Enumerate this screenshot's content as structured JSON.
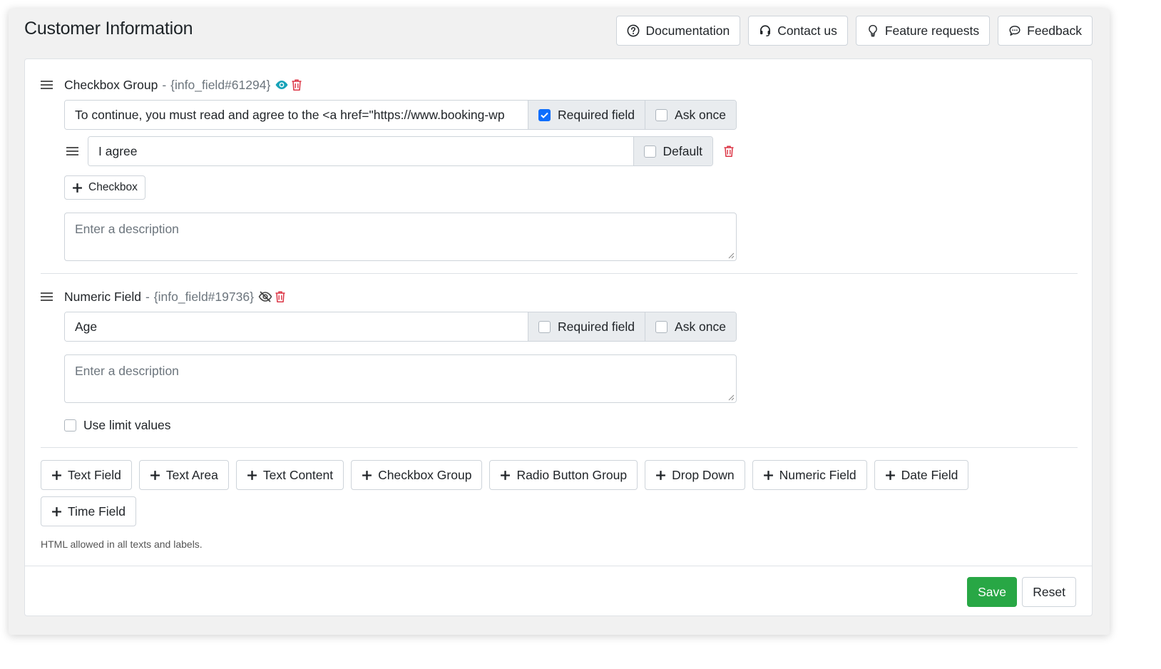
{
  "header": {
    "title": "Customer Information",
    "buttons": [
      {
        "label": "Documentation",
        "icon": "question-circle-icon"
      },
      {
        "label": "Contact us",
        "icon": "headset-icon"
      },
      {
        "label": "Feature requests",
        "icon": "lightbulb-icon"
      },
      {
        "label": "Feedback",
        "icon": "chat-bubble-icon"
      }
    ]
  },
  "fields": [
    {
      "type": "Checkbox Group",
      "separator": "-",
      "token": "{info_field#61294}",
      "visibility": "visible",
      "label_value": "To continue, you must read and agree to the <a href=\"https://www.booking-wp",
      "required_label": "Required field",
      "required_checked": true,
      "ask_once_label": "Ask once",
      "ask_once_checked": false,
      "options": [
        {
          "value": "I agree",
          "default_label": "Default",
          "default_checked": false
        }
      ],
      "add_checkbox_label": "Checkbox",
      "description_placeholder": "Enter a description"
    },
    {
      "type": "Numeric Field",
      "separator": "-",
      "token": "{info_field#19736}",
      "visibility": "hidden",
      "label_value": "Age",
      "required_label": "Required field",
      "required_checked": false,
      "ask_once_label": "Ask once",
      "ask_once_checked": false,
      "description_placeholder": "Enter a description",
      "limit_values_label": "Use limit values",
      "limit_values_checked": false
    }
  ],
  "add_buttons": [
    "Text Field",
    "Text Area",
    "Text Content",
    "Checkbox Group",
    "Radio Button Group",
    "Drop Down",
    "Numeric Field",
    "Date Field",
    "Time Field"
  ],
  "help_text": "HTML allowed in all texts and labels.",
  "footer": {
    "save_label": "Save",
    "reset_label": "Reset"
  },
  "colors": {
    "accent": "#0d6efd",
    "danger": "#dc3545",
    "success": "#28a745",
    "eye": "#17a2b8"
  }
}
